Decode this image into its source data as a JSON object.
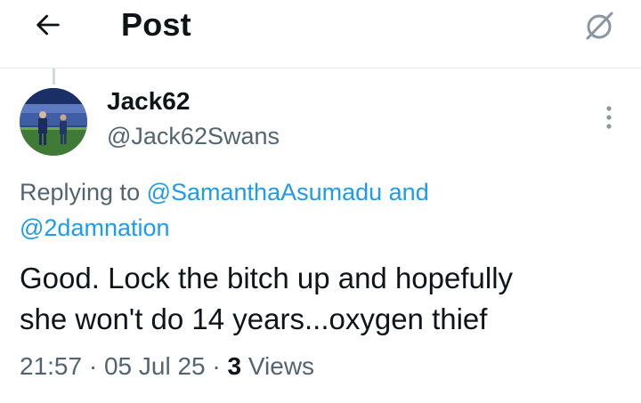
{
  "header": {
    "title": "Post",
    "back_icon": "arrow-left-icon",
    "grok_icon": "grok-icon"
  },
  "post": {
    "author": {
      "display_name": "Jack62",
      "handle": "@Jack62Swans"
    },
    "replying": {
      "prefix": "Replying to ",
      "mention1": "@SamanthaAsumadu",
      "joiner": " and",
      "mention2": "@2damnation"
    },
    "text": {
      "line1": "Good. Lock the bitch up and hopefully",
      "line2": "she won't do 14 years...oxygen thief"
    },
    "meta": {
      "time": "21:57",
      "sep1": " · ",
      "date": "05 Jul 25",
      "sep2": " · ",
      "views_count": "3",
      "views_label": " Views"
    }
  },
  "colors": {
    "accent": "#1d9bf0",
    "secondary_text": "#536471",
    "primary_text": "#0f1419",
    "divider": "#e6e9ec"
  }
}
